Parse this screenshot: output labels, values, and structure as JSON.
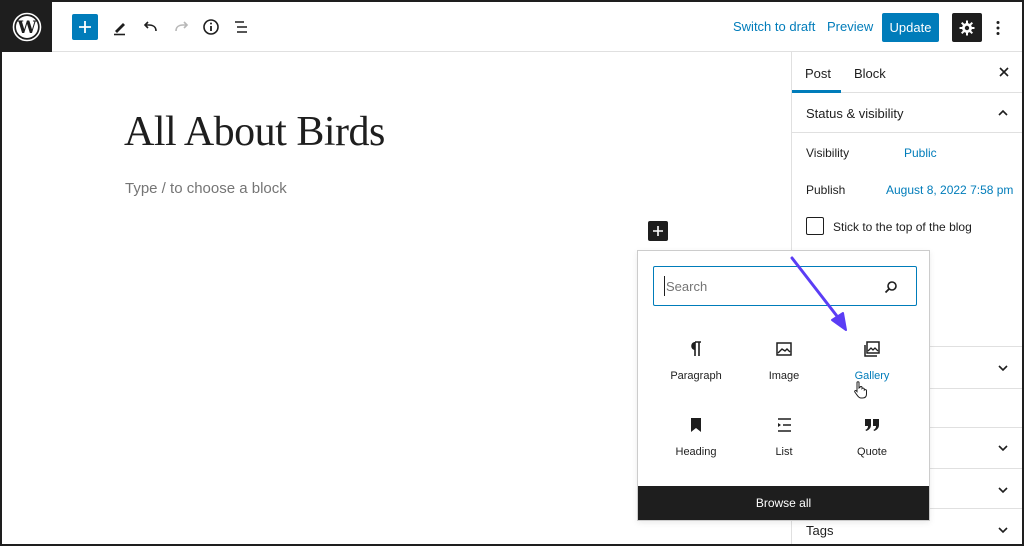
{
  "topbar": {
    "switch_to_draft": "Switch to draft",
    "preview": "Preview",
    "update": "Update"
  },
  "editor": {
    "title": "All About Birds",
    "placeholder": "Type / to choose a block"
  },
  "sidebar": {
    "tabs": [
      {
        "label": "Post",
        "active": true
      },
      {
        "label": "Block",
        "active": false
      }
    ],
    "status_visibility": {
      "label": "Status & visibility",
      "visibility_label": "Visibility",
      "visibility_value": "Public",
      "publish_label": "Publish",
      "publish_value": "August 8, 2022 7:58 pm",
      "sticky_label": "Stick to the top of the blog",
      "sticky_checked": false
    },
    "tags_label": "Tags"
  },
  "inserter": {
    "search_placeholder": "Search",
    "blocks": [
      {
        "label": "Paragraph",
        "icon": "paragraph-icon"
      },
      {
        "label": "Image",
        "icon": "image-icon"
      },
      {
        "label": "Gallery",
        "icon": "gallery-icon",
        "hovered": true
      },
      {
        "label": "Heading",
        "icon": "heading-icon"
      },
      {
        "label": "List",
        "icon": "list-icon"
      },
      {
        "label": "Quote",
        "icon": "quote-icon"
      }
    ],
    "browse_all": "Browse all"
  },
  "colors": {
    "accent": "#007cba",
    "dark": "#1e1e1e",
    "annotation_arrow": "#5b3df5"
  }
}
